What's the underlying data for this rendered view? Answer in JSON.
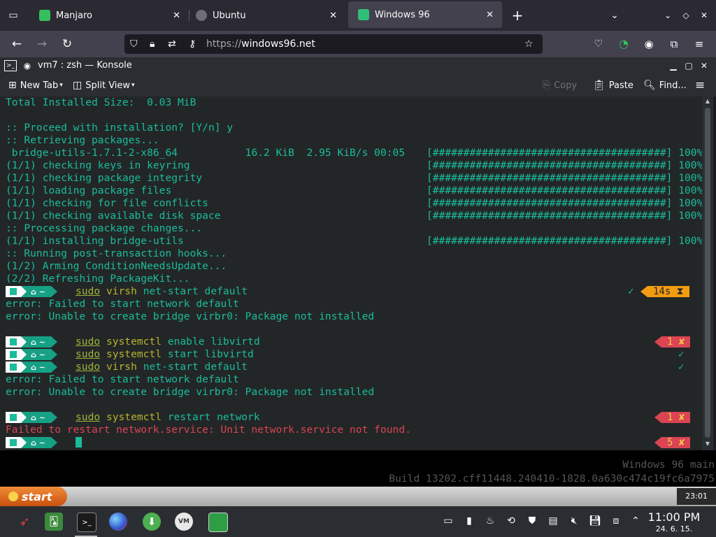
{
  "browser": {
    "tabs": [
      {
        "label": "Manjaro",
        "active": false
      },
      {
        "label": "Ubuntu",
        "active": false
      },
      {
        "label": "Windows 96",
        "active": true
      }
    ],
    "new_tab": "+",
    "url_scheme": "https://",
    "url_host": "windows96.net"
  },
  "konsole": {
    "title": "vm7 : zsh — Konsole",
    "toolbar": {
      "new_tab": "New Tab",
      "split_view": "Split View",
      "copy": "Copy",
      "paste": "Paste",
      "find": "Find..."
    }
  },
  "terminal": {
    "lines": [
      "Total Installed Size:  0.03 MiB",
      "",
      ":: Proceed with installation? [Y/n] y",
      ":: Retrieving packages...",
      " bridge-utils-1.7.1-2-x86_64           16.2 KiB  2.95 KiB/s 00:05",
      "(1/1) checking keys in keyring",
      "(1/1) checking package integrity",
      "(1/1) loading package files",
      "(1/1) checking for file conflicts",
      "(1/1) checking available disk space",
      ":: Processing package changes...",
      "(1/1) installing bridge-utils",
      ":: Running post-transaction hooks...",
      "(1/2) Arming ConditionNeedsUpdate...",
      "(2/2) Refreshing PackageKit..."
    ],
    "progress_bar": "[######################################] 100%",
    "prompt_dir": "⌂ ~",
    "commands": [
      {
        "sudo": "sudo",
        "bin": "virsh",
        "args": "net-start default"
      },
      {
        "sudo": "sudo",
        "bin": "systemctl",
        "args": "enable libvirtd"
      },
      {
        "sudo": "sudo",
        "bin": "systemctl",
        "args": "start libvirtd"
      },
      {
        "sudo": "sudo",
        "bin": "virsh",
        "args": "net-start default"
      },
      {
        "sudo": "sudo",
        "bin": "systemctl",
        "args": "restart network"
      }
    ],
    "errors": {
      "e1": "error: Failed to start network default",
      "e2": "error: Unable to create bridge virbr0: Package not installed",
      "e3": "error: Failed to start network default",
      "e4": "error: Unable to create bridge virbr0: Package not installed",
      "red": "Failed to restart network.service: Unit network.service not found."
    },
    "status": {
      "s1_check": "✓",
      "s1_time": "14s ⧗",
      "s2": "1 ✘",
      "s3": "✓",
      "s4": "✓",
      "s5": "1 ✘",
      "s6": "5 ✘"
    }
  },
  "win96": {
    "watermark_1": "Windows 96 main",
    "watermark_2": "Build 13202.cff11448.240410-1828.0a630c474c19fc6a7975",
    "start": "start",
    "clock": "23:01"
  },
  "taskbar": {
    "time": "11:00 PM",
    "date": "24. 6. 15."
  },
  "colors": {
    "terminal_bg": "#232627",
    "text": "#1abc9c",
    "error": "#da4453"
  }
}
